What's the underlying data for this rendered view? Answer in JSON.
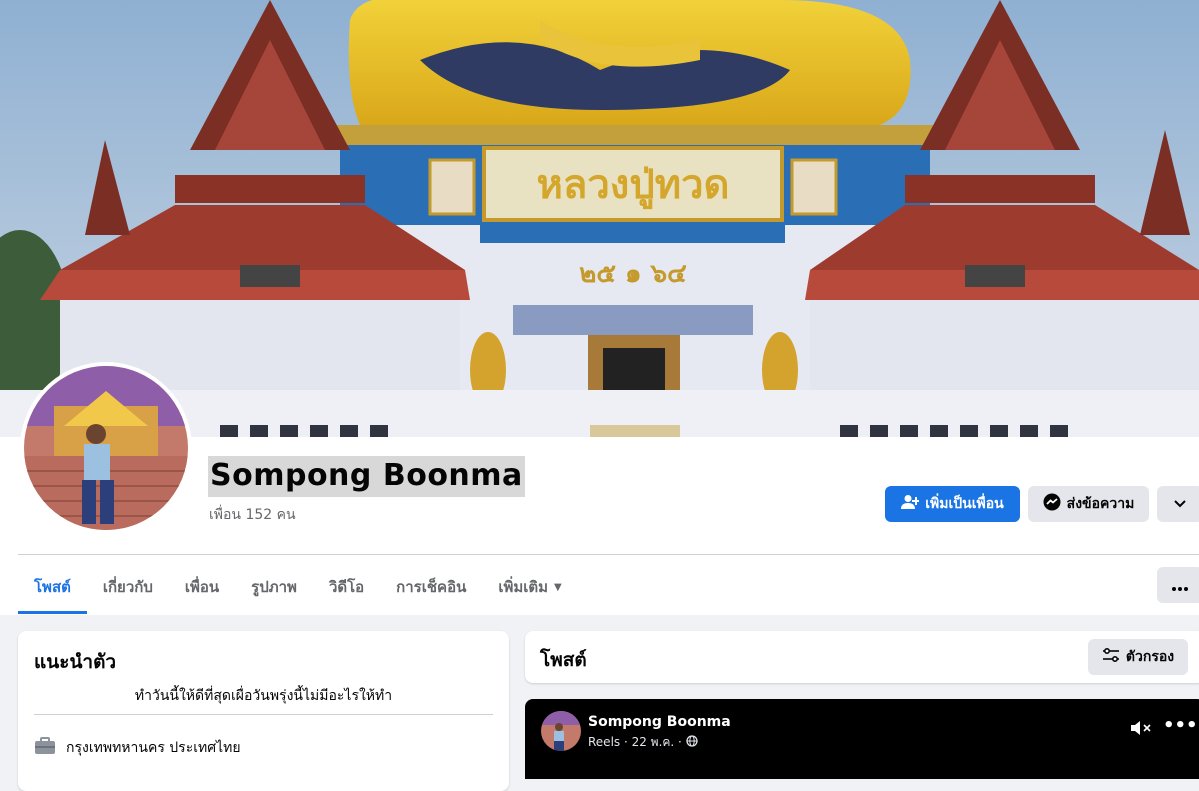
{
  "profile": {
    "name": "Sompong Boonma",
    "friends": "เพื่อน 152 คน"
  },
  "cover": {
    "sign_text": "หลวงปู่ทวด",
    "year_text": "๒๕ ๑ ๖๔"
  },
  "actions": {
    "add_friend": "เพิ่มเป็นเพื่อน",
    "message": "ส่งข้อความ"
  },
  "tabs": [
    {
      "label": "โพสต์",
      "active": true
    },
    {
      "label": "เกี่ยวกับ",
      "active": false
    },
    {
      "label": "เพื่อน",
      "active": false
    },
    {
      "label": "รูปภาพ",
      "active": false
    },
    {
      "label": "วิดีโอ",
      "active": false
    },
    {
      "label": "การเช็คอิน",
      "active": false
    },
    {
      "label": "เพิ่มเติม",
      "active": false
    }
  ],
  "intro": {
    "title": "แนะนำตัว",
    "bio": "ทำวันนี้ให้ดีที่สุดเผื่อวันพรุ่งนี้ไม่มีอะไรให้ทำ",
    "location": "กรุงเทพทหานคร ประเทศไทย"
  },
  "posts": {
    "title": "โพสต์",
    "filter_label": "ตัวกรอง"
  },
  "reel_post": {
    "author": "Sompong Boonma",
    "meta": "Reels · 22 พ.ค. ·"
  },
  "colors": {
    "accent": "#1b74e4",
    "background": "#f0f2f5",
    "secondary_button": "#e4e6eb"
  },
  "icons": [
    "add-friend-icon",
    "messenger-icon",
    "chevron-down-icon",
    "more-dots-icon",
    "filter-icon",
    "briefcase-icon",
    "globe-icon",
    "mute-icon"
  ]
}
